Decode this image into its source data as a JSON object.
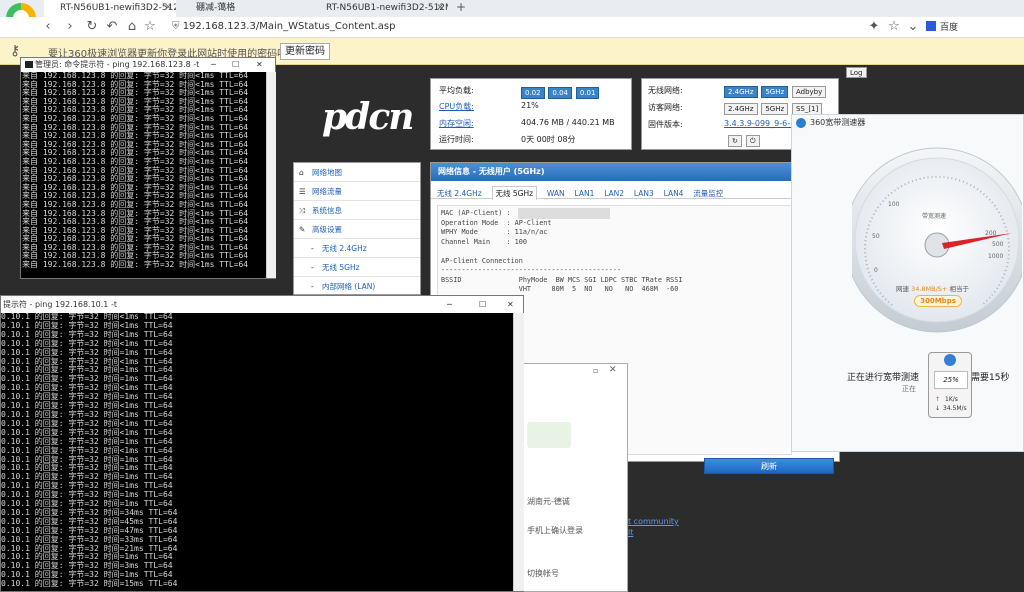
{
  "browser": {
    "tabs": [
      {
        "title": "RT-N56UB1-newifi3D2-512M",
        "close": "✕"
      },
      {
        "title": "硼减-蔼格"
      },
      {
        "title": "RT-N56UB1-newifi3D2-512M",
        "close": "✕"
      }
    ],
    "new_tab": "+",
    "url": "192.168.123.3/Main_WStatus_Content.asp",
    "search_label": "百度",
    "infobar_text": "要让360极速浏览器更新你登录此网站时使用的密码吗？",
    "infobar_button": "更新密码"
  },
  "router": {
    "logo": "pdcn",
    "log_button": "Log",
    "status": {
      "load_label": "平均负载:",
      "load_values": [
        "0.02",
        "0.04",
        "0.01"
      ],
      "cpu_label": "CPU负载:",
      "cpu_value": "21%",
      "mem_label": "内存空闲:",
      "mem_value": "404.76 MB / 440.21 MB",
      "uptime_label": "运行时间:",
      "uptime_value": "0天 00时 08分"
    },
    "wireless": {
      "net_label": "无线网络:",
      "btn_24": "2.4GHz",
      "btn_5": "5GHz",
      "btn_adbyby": "Adbyby",
      "guest_label": "访客网络:",
      "guest_24": "2.4GHz",
      "guest_5": "5GHz",
      "ss": "SS_[1]",
      "fw_label": "固件版本:",
      "fw_value": "3.4.3.9-099_9-6-18"
    },
    "menu": [
      {
        "label": "网络地图"
      },
      {
        "label": "网络流量"
      },
      {
        "label": "系统信息"
      },
      {
        "label": "高级设置"
      },
      {
        "label": "无线 2.4GHz"
      },
      {
        "label": "无线 5GHz"
      },
      {
        "label": "内部网络 (LAN)"
      }
    ],
    "netinfo": {
      "title": "网络信息 - 无线用户 (5GHz)",
      "tabs": [
        "无线 2.4GHz",
        "无线 5GHz",
        "WAN",
        "LAN1",
        "LAN2",
        "LAN3",
        "LAN4",
        "流量监控"
      ],
      "body": "MAC (AP-Client) :\nOperation Mode  : AP-Client\nWPHY Mode       : 11a/n/ac\nChannel Main    : 100\n\nAP-Client Connection\n--------------------------------------------\nBSSID              PhyMode  BW MCS SGI LDPC STBC TRate RSSI\n                   VHT     80M  5  NO   NO   NO  468M  -60",
      "refresh": "刷新"
    },
    "footer_text": [
      "t community",
      "lt"
    ]
  },
  "cmd_small": {
    "title": "管理员: 命令提示符 - ping  192.168.123.8 -t",
    "lines": [
      "来自 192.168.123.8 的回复: 字节=32 时间<1ms TTL=64",
      "来自 192.168.123.8 的回复: 字节=32 时间<1ms TTL=64",
      "来自 192.168.123.8 的回复: 字节=32 时间<1ms TTL=64",
      "来自 192.168.123.8 的回复: 字节=32 时间<1ms TTL=64",
      "来自 192.168.123.8 的回复: 字节=32 时间<1ms TTL=64",
      "来自 192.168.123.8 的回复: 字节=32 时间<1ms TTL=64",
      "来自 192.168.123.8 的回复: 字节=32 时间<1ms TTL=64",
      "来自 192.168.123.8 的回复: 字节=32 时间<1ms TTL=64",
      "来自 192.168.123.8 的回复: 字节=32 时间<1ms TTL=64",
      "来自 192.168.123.8 的回复: 字节=32 时间<1ms TTL=64",
      "来自 192.168.123.8 的回复: 字节=32 时间<1ms TTL=64",
      "来自 192.168.123.8 的回复: 字节=32 时间<1ms TTL=64",
      "来自 192.168.123.8 的回复: 字节=32 时间<1ms TTL=64",
      "来自 192.168.123.8 的回复: 字节=32 时间<1ms TTL=64",
      "来自 192.168.123.8 的回复: 字节=32 时间<1ms TTL=64",
      "来自 192.168.123.8 的回复: 字节=32 时间<1ms TTL=64",
      "来自 192.168.123.8 的回复: 字节=32 时间<1ms TTL=64",
      "来自 192.168.123.8 的回复: 字节=32 时间<1ms TTL=64",
      "来自 192.168.123.8 的回复: 字节=32 时间<1ms TTL=64",
      "来自 192.168.123.8 的回复: 字节=32 时间<1ms TTL=64",
      "来自 192.168.123.8 的回复: 字节=32 时间<1ms TTL=64",
      "来自 192.168.123.8 的回复: 字节=32 时间<1ms TTL=64",
      "来自 192.168.123.8 的回复: 字节=32 时间<1ms TTL=64"
    ]
  },
  "cmd_large": {
    "title": "提示符 - ping  192.168.10.1 -t",
    "lines": [
      "0.10.1 的回复: 字节=32 时间<1ms TTL=64",
      "0.10.1 的回复: 字节=32 时间<1ms TTL=64",
      "0.10.1 的回复: 字节=32 时间<1ms TTL=64",
      "0.10.1 的回复: 字节=32 时间<1ms TTL=64",
      "0.10.1 的回复: 字节=32 时间=1ms TTL=64",
      "0.10.1 的回复: 字节=32 时间<1ms TTL=64",
      "0.10.1 的回复: 字节=32 时间=1ms TTL=64",
      "0.10.1 的回复: 字节=32 时间=1ms TTL=64",
      "0.10.1 的回复: 字节=32 时间<1ms TTL=64",
      "0.10.1 的回复: 字节=32 时间=1ms TTL=64",
      "0.10.1 的回复: 字节=32 时间<1ms TTL=64",
      "0.10.1 的回复: 字节=32 时间<1ms TTL=64",
      "0.10.1 的回复: 字节=32 时间<1ms TTL=64",
      "0.10.1 的回复: 字节=32 时间<1ms TTL=64",
      "0.10.1 的回复: 字节=32 时间=1ms TTL=64",
      "0.10.1 的回复: 字节=32 时间<1ms TTL=64",
      "0.10.1 的回复: 字节=32 时间=1ms TTL=64",
      "0.10.1 的回复: 字节=32 时间=1ms TTL=64",
      "0.10.1 的回复: 字节=32 时间=1ms TTL=64",
      "0.10.1 的回复: 字节=32 时间=1ms TTL=64",
      "0.10.1 的回复: 字节=32 时间=1ms TTL=64",
      "0.10.1 的回复: 字节=32 时间=1ms TTL=64",
      "0.10.1 的回复: 字节=32 时间=34ms TTL=64",
      "0.10.1 的回复: 字节=32 时间=45ms TTL=64",
      "0.10.1 的回复: 字节=32 时间=47ms TTL=64",
      "0.10.1 的回复: 字节=32 时间=33ms TTL=64",
      "0.10.1 的回复: 字节=32 时间=21ms TTL=64",
      "0.10.1 的回复: 字节=32 时间=1ms TTL=64",
      "0.10.1 的回复: 字节=32 时间=3ms TTL=64",
      "0.10.1 的回复: 字节=32 时间=1ms TTL=64",
      "0.10.1 的回复: 字节=32 时间=15ms TTL=64"
    ]
  },
  "login_popup": {
    "text1": "湖南元-德诚",
    "text2": "手机上确认登录",
    "text3": "切换帐号"
  },
  "speedtest": {
    "title": "360宽带测速器",
    "dial_label": "带宽测速",
    "ticks": [
      "0",
      "50",
      "100",
      "200",
      "500",
      "1000"
    ],
    "speed_prefix": "网速",
    "speed_value": "34.8MB/S+",
    "speed_mid": "相当于",
    "speed_equiv": "300Mbps",
    "status": "正在进行宽带测速",
    "status_tail": "需要15秒",
    "sub": "正在",
    "badge_percent": "25%",
    "upload": "1K/s",
    "download": "34.5M/s"
  }
}
